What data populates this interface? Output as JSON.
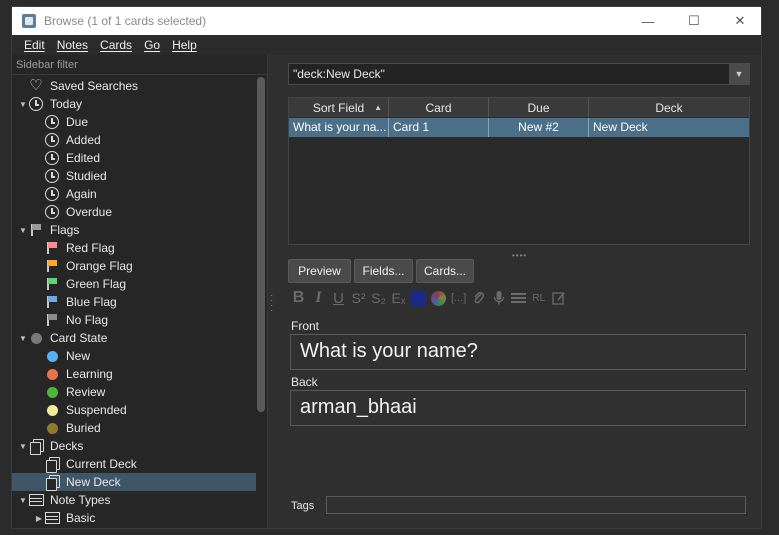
{
  "window": {
    "title": "Browse (1 of 1 cards selected)",
    "controls": {
      "minimize": "—",
      "maximize": "☐",
      "close": "✕"
    }
  },
  "menu": [
    "Edit",
    "Notes",
    "Cards",
    "Go",
    "Help"
  ],
  "sidebar": {
    "filter_placeholder": "Sidebar filter",
    "items": [
      {
        "label": "Saved Searches",
        "icon": "heart-icon",
        "level": 0
      },
      {
        "label": "Today",
        "icon": "clock-icon",
        "level": 0,
        "expanded": true
      },
      {
        "label": "Due",
        "icon": "clock-icon",
        "level": 1
      },
      {
        "label": "Added",
        "icon": "clock-icon",
        "level": 1
      },
      {
        "label": "Edited",
        "icon": "clock-icon",
        "level": 1
      },
      {
        "label": "Studied",
        "icon": "clock-icon",
        "level": 1
      },
      {
        "label": "Again",
        "icon": "clock-icon",
        "level": 1
      },
      {
        "label": "Overdue",
        "icon": "clock-icon",
        "level": 1
      },
      {
        "label": "Flags",
        "icon": "flag-icon",
        "level": 0,
        "expanded": true,
        "color": "#9a9a9a"
      },
      {
        "label": "Red Flag",
        "icon": "flag-icon",
        "level": 1,
        "color": "#ff8a8a"
      },
      {
        "label": "Orange Flag",
        "icon": "flag-icon",
        "level": 1,
        "color": "#f3a82e"
      },
      {
        "label": "Green Flag",
        "icon": "flag-icon",
        "level": 1,
        "color": "#5fd07a"
      },
      {
        "label": "Blue Flag",
        "icon": "flag-icon",
        "level": 1,
        "color": "#6fa8dc"
      },
      {
        "label": "No Flag",
        "icon": "flag-icon",
        "level": 1,
        "color": "#8a8a8a"
      },
      {
        "label": "Card State",
        "icon": "dot-icon",
        "level": 0,
        "expanded": true,
        "color": "#7a7a7a"
      },
      {
        "label": "New",
        "icon": "dot-icon",
        "level": 1,
        "color": "#5ab0f0"
      },
      {
        "label": "Learning",
        "icon": "dot-icon",
        "level": 1,
        "color": "#e8744f"
      },
      {
        "label": "Review",
        "icon": "dot-icon",
        "level": 1,
        "color": "#4fb63c"
      },
      {
        "label": "Suspended",
        "icon": "dot-icon",
        "level": 1,
        "color": "#f2ea9c"
      },
      {
        "label": "Buried",
        "icon": "dot-icon",
        "level": 1,
        "color": "#8a7d30"
      },
      {
        "label": "Decks",
        "icon": "cards-icon",
        "level": 0,
        "expanded": true
      },
      {
        "label": "Current Deck",
        "icon": "cards-icon",
        "level": 1
      },
      {
        "label": "New Deck",
        "icon": "cards-icon",
        "level": 1,
        "selected": true
      },
      {
        "label": "Note Types",
        "icon": "notetype-icon",
        "level": 0,
        "expanded": true
      },
      {
        "label": "Basic",
        "icon": "notetype-icon",
        "level": 1,
        "collapsed": true
      }
    ]
  },
  "search": {
    "value": "\"deck:New Deck\""
  },
  "table": {
    "columns": [
      "Sort Field",
      "Card",
      "Due",
      "Deck"
    ],
    "rows": [
      [
        "What is your na...",
        "Card 1",
        "New #2",
        "New Deck"
      ]
    ]
  },
  "editor": {
    "buttons": {
      "preview": "Preview",
      "fields": "Fields...",
      "cards": "Cards..."
    },
    "toolbar": {
      "bold": "B",
      "italic": "I",
      "underline": "U",
      "superscript": "S²",
      "subscript": "S₂",
      "clear_format": "Eₓ",
      "cloze": "[...]",
      "rtl": "RL"
    },
    "text_color": "#1a2a8a",
    "front_label": "Front",
    "front_value": "What is your name?",
    "back_label": "Back",
    "back_value": "arman_bhaai",
    "tags_label": "Tags"
  }
}
